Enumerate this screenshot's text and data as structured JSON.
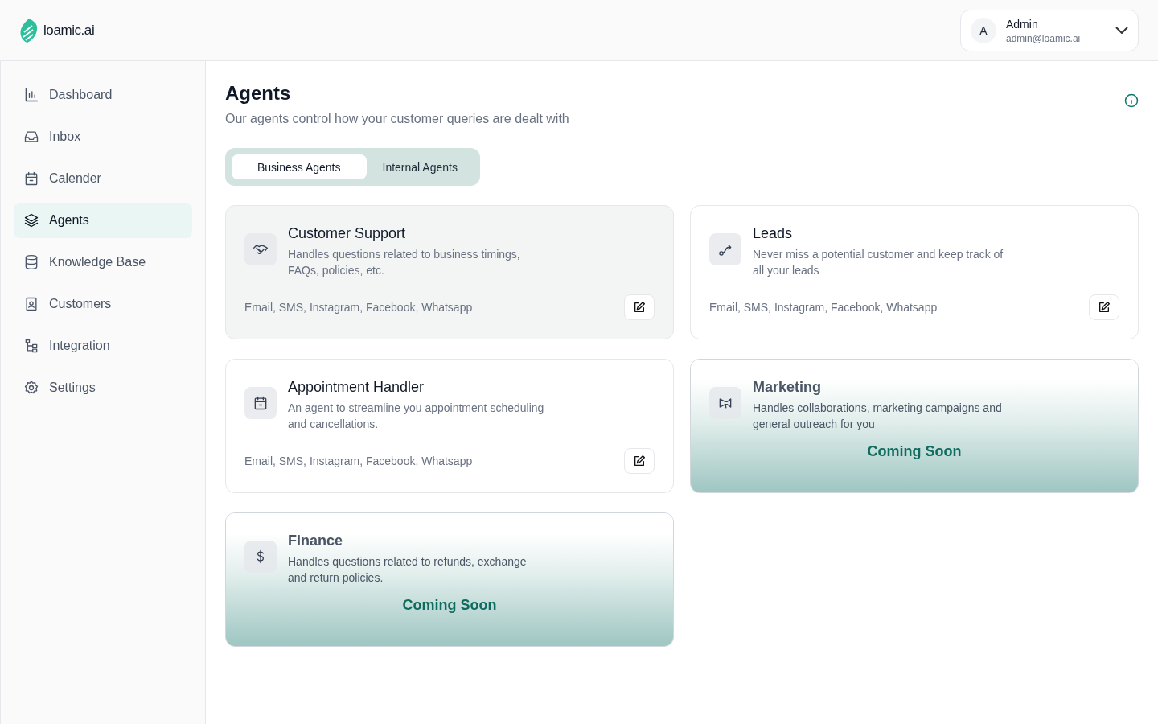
{
  "brand": {
    "name": "loamic.ai"
  },
  "user": {
    "initial": "A",
    "name": "Admin",
    "email": "admin@loamic.ai"
  },
  "sidebar": {
    "items": [
      {
        "label": "Dashboard",
        "selected": false
      },
      {
        "label": "Inbox",
        "selected": false
      },
      {
        "label": "Calender",
        "selected": false
      },
      {
        "label": "Agents",
        "selected": true
      },
      {
        "label": "Knowledge Base",
        "selected": false
      },
      {
        "label": "Customers",
        "selected": false
      },
      {
        "label": "Integration",
        "selected": false
      },
      {
        "label": "Settings",
        "selected": false
      }
    ]
  },
  "page": {
    "title": "Agents",
    "subtitle": "Our agents control how your customer queries are dealt with"
  },
  "tabs": [
    {
      "label": "Business Agents",
      "selected": true
    },
    {
      "label": "Internal Agents",
      "selected": false
    }
  ],
  "cards": [
    {
      "kind": "active",
      "selected": true,
      "title": "Customer Support",
      "description": "Handles questions related to business timings, FAQs, policies, etc.",
      "channels": "Email, SMS, Instagram, Facebook, Whatsapp"
    },
    {
      "kind": "active",
      "selected": false,
      "title": "Leads",
      "description": "Never miss a potential customer and keep track of all your leads",
      "channels": "Email, SMS, Instagram, Facebook, Whatsapp"
    },
    {
      "kind": "active",
      "selected": false,
      "title": "Appointment Handler",
      "description": "An agent to streamline you appointment scheduling and cancellations.",
      "channels": "Email, SMS, Instagram, Facebook, Whatsapp"
    },
    {
      "kind": "coming_soon",
      "title": "Marketing",
      "description": "Handles collaborations, marketing campaigns and general outreach for you",
      "badge": "Coming Soon"
    },
    {
      "kind": "coming_soon",
      "title": "Finance",
      "description": "Handles questions related to refunds, exchange and return policies.",
      "badge": "Coming Soon"
    }
  ]
}
